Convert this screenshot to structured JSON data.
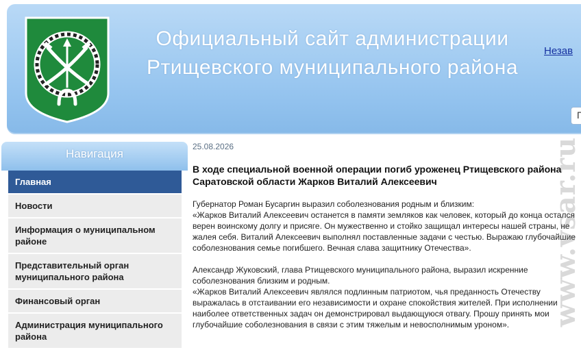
{
  "header": {
    "title_line1": "Официальный сайт администрации",
    "title_line2": "Ртищевского муниципального района",
    "top_link": "Незав",
    "search_value": "П",
    "crest_icon": "coat-of-arms-icon"
  },
  "sidebar": {
    "title": "Навигация",
    "items": [
      {
        "label": "Главная"
      },
      {
        "label": "Новости"
      },
      {
        "label": "Информация о муниципальном районе"
      },
      {
        "label": "Представительный орган муниципального района"
      },
      {
        "label": "Финансовый орган"
      },
      {
        "label": "Администрация муниципального района"
      }
    ]
  },
  "article": {
    "date": "25.08.2026",
    "headline": "В ходе специальной военной операции погиб уроженец Ртищевского района Саратовской области Жарков Виталий Алексеевич",
    "p1_intro": "Губернатор Роман Бусаргин выразил соболезнования родным и близким:",
    "p1_quote": "«Жарков Виталий Алексеевич останется в памяти земляков как человек, который до конца остался верен воинскому долгу и присяге. Он мужественно и стойко защищал интересы нашей страны, не жалея себя. Виталий Алексеевич выполнял поставленные задачи с честью. Выражаю глубочайшие соболезнования семье погибшего. Вечная слава защитнику Отечества».",
    "p2_intro": "Александр Жуковский, глава Ртищевского муниципального района, выразил искренние соболезнования близким и родным.",
    "p2_quote": "«Жарков Виталий Алексеевич являлся подлинным патриотом, чья преданность Отечеству выражалась в отстаивании его независимости и охране спокойствия жителей. При исполнении наиболее ответственных задач он демонстрировал выдающуюся отвагу. Прошу принять мои глубочайшие соболезнования в связи с этим тяжелым и невосполнимым уроном»."
  },
  "watermark": {
    "text": "www.vsar.ru"
  },
  "colors": {
    "header_gradient_top": "#b9d9f6",
    "header_gradient_bottom": "#86b9e8",
    "nav_active": "#2f5a97",
    "nav_item_bg": "#ececec",
    "crest_green": "#1f8a3c",
    "link_blue": "#1530a0"
  }
}
